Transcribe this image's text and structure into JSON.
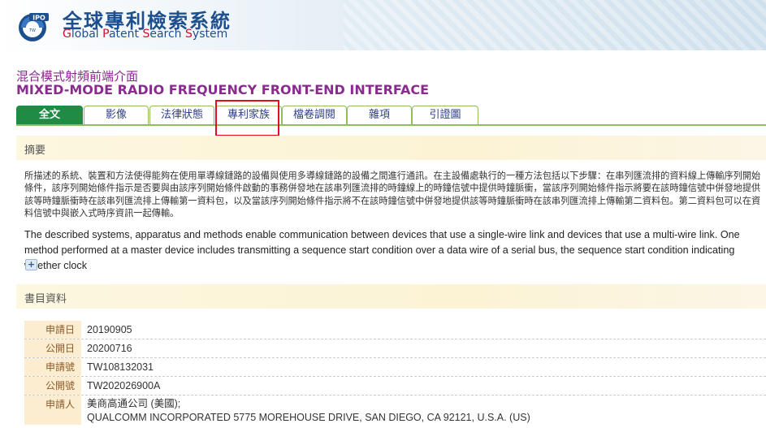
{
  "header": {
    "title_zh": "全球專利檢索系統",
    "title_en_parts": [
      "G",
      "lobal ",
      "P",
      "atent ",
      "S",
      "earch ",
      "S",
      "ystem"
    ]
  },
  "patent": {
    "title_zh": "混合模式射頻前端介面",
    "title_en": "MIXED-MODE RADIO FREQUENCY FRONT-END INTERFACE"
  },
  "tabs": [
    {
      "label": "全文",
      "active": true
    },
    {
      "label": "影像",
      "active": false
    },
    {
      "label": "法律狀態",
      "active": false
    },
    {
      "label": "專利家族",
      "active": false
    },
    {
      "label": "檔卷調閱",
      "active": false
    },
    {
      "label": "雜項",
      "active": false
    },
    {
      "label": "引證圖",
      "active": false
    }
  ],
  "abstract": {
    "heading": "摘要",
    "text_zh": "所描述的系統、裝置和方法使得能夠在使用單導線鏈路的設備與使用多導線鏈路的設備之間進行通訊。在主設備處執行的一種方法包括以下步驟：在串列匯流排的資料線上傳輸序列開始條件，該序列開始條件指示是否要與由該序列開始條件啟動的事務併發地在該串列匯流排的時鐘線上的時鐘信號中提供時鐘脈衝，當該序列開始條件指示將要在該時鐘信號中併發地提供該等時鐘脈衝時在該串列匯流排上傳輸第一資料包，以及當該序列開始條件指示將不在該時鐘信號中併發地提供該等時鐘脈衝時在該串列匯流排上傳輸第二資料包。第二資料包可以在資料信號中與嵌入式時序資訊一起傳輸。",
    "text_en": "The described systems, apparatus and methods enable communication between devices that use a single-wire link and devices that use a multi-wire link. One method performed at a master device includes transmitting a sequence start condition over a data wire of a serial bus, the sequence start condition indicating whether clock",
    "expand_symbol": "+"
  },
  "bibliography": {
    "heading": "書目資料",
    "rows": [
      {
        "label": "申請日",
        "value": "20190905"
      },
      {
        "label": "公開日",
        "value": "20200716"
      },
      {
        "label": "申請號",
        "value": "TW108132031"
      },
      {
        "label": "公開號",
        "value": "TW202026900A"
      },
      {
        "label": "申請人",
        "value": "美商高通公司 (美國);",
        "value2": "QUALCOMM INCORPORATED 5775 MOREHOUSE DRIVE, SAN DIEGO, CA 92121, U.S.A. (US)"
      }
    ]
  },
  "colors": {
    "brand_blue": "#1d4f8f",
    "title_purple": "#8a2b8f",
    "tab_active": "#1f8b44",
    "highlight_red": "#e0101a"
  }
}
